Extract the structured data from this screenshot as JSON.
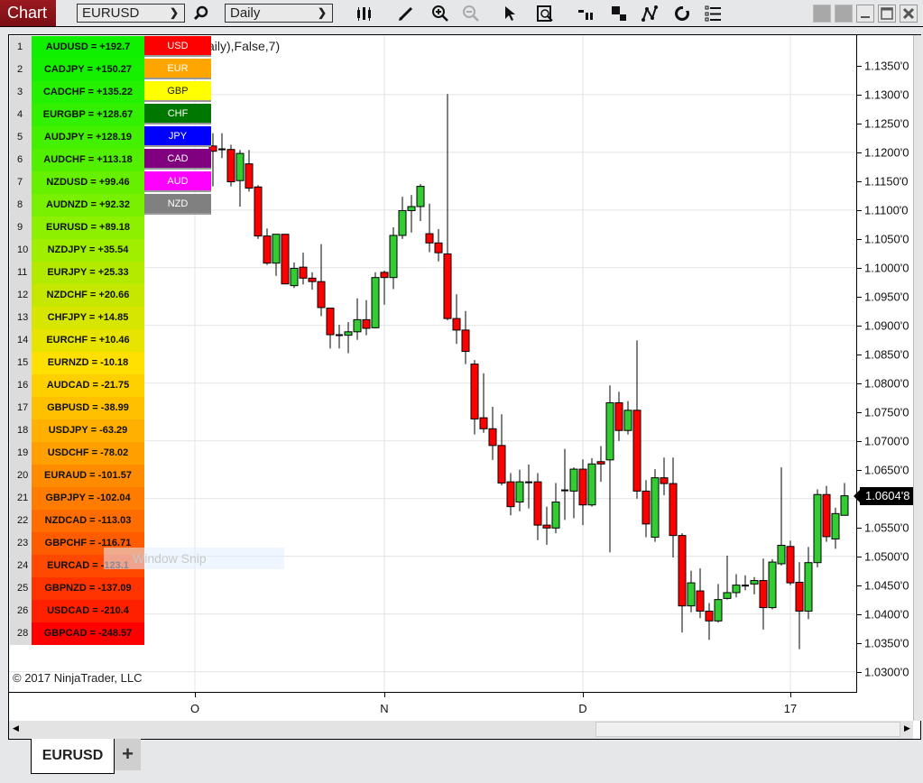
{
  "window": {
    "title": "Chart",
    "instrument": "EURUSD",
    "interval": "Daily",
    "tab_label": "EURUSD",
    "add_tab_label": "+"
  },
  "toolbar": {
    "icons": [
      "bar-type-icon",
      "draw-pencil-icon",
      "zoom-in-icon",
      "zoom-out-icon",
      "pointer-icon",
      "data-box-icon",
      "chart-trader-icon",
      "tile-windows-icon",
      "drawing-tool-icon",
      "reload-icon",
      "properties-list-icon"
    ]
  },
  "overlay": {
    "indicator_label": "aily),False,7)",
    "copyright": "© 2017 NinjaTrader, LLC",
    "snip_text": "Window Snip",
    "last_price_label": "1.0604'8"
  },
  "rank_table": [
    {
      "rank": "1",
      "label": "AUDUSD = +192.7",
      "color": "#0ff000"
    },
    {
      "rank": "2",
      "label": "CADJPY = +150.27",
      "color": "#15f000"
    },
    {
      "rank": "3",
      "label": "CADCHF = +135.22",
      "color": "#24f000"
    },
    {
      "rank": "4",
      "label": "EURGBP = +128.67",
      "color": "#33f000"
    },
    {
      "rank": "5",
      "label": "AUDJPY = +128.19",
      "color": "#42f000"
    },
    {
      "rank": "6",
      "label": "AUDCHF = +113.18",
      "color": "#52f000"
    },
    {
      "rank": "7",
      "label": "NZDUSD = +99.46",
      "color": "#66f000"
    },
    {
      "rank": "8",
      "label": "AUDNZD = +92.32",
      "color": "#78f000"
    },
    {
      "rank": "9",
      "label": "EURUSD = +89.18",
      "color": "#8cf000"
    },
    {
      "rank": "10",
      "label": "NZDJPY = +35.54",
      "color": "#a0ee00"
    },
    {
      "rank": "11",
      "label": "EURJPY = +25.33",
      "color": "#b4ea00"
    },
    {
      "rank": "12",
      "label": "NZDCHF = +20.66",
      "color": "#c6e800"
    },
    {
      "rank": "13",
      "label": "CHFJPY = +14.85",
      "color": "#d6e600"
    },
    {
      "rank": "14",
      "label": "EURCHF = +10.46",
      "color": "#e6e400"
    },
    {
      "rank": "15",
      "label": "EURNZD = -10.18",
      "color": "#ffe000"
    },
    {
      "rank": "16",
      "label": "AUDCAD = -21.75",
      "color": "#ffd000"
    },
    {
      "rank": "17",
      "label": "GBPUSD = -38.99",
      "color": "#ffc000"
    },
    {
      "rank": "18",
      "label": "USDJPY = -63.29",
      "color": "#ffb000"
    },
    {
      "rank": "19",
      "label": "USDCHF = -78.02",
      "color": "#ffa000"
    },
    {
      "rank": "20",
      "label": "EURAUD = -101.57",
      "color": "#ff8c00"
    },
    {
      "rank": "21",
      "label": "GBPJPY = -102.04",
      "color": "#ff7c00"
    },
    {
      "rank": "22",
      "label": "NZDCAD = -113.03",
      "color": "#ff6c00"
    },
    {
      "rank": "23",
      "label": "GBPCHF = -116.71",
      "color": "#ff5c00"
    },
    {
      "rank": "24",
      "label": "EURCAD = -123.1",
      "color": "#ff4800"
    },
    {
      "rank": "25",
      "label": "GBPNZD = -137.09",
      "color": "#ff3400"
    },
    {
      "rank": "26",
      "label": "USDCAD = -210.4",
      "color": "#ff2000"
    },
    {
      "rank": "28",
      "label": "GBPCAD = -248.57",
      "color": "#ff0000"
    }
  ],
  "currencies": [
    {
      "label": "USD",
      "bg": "#ff0000",
      "fg": "#ffffff"
    },
    {
      "label": "EUR",
      "bg": "#ffa500",
      "fg": "#ffffff"
    },
    {
      "label": "GBP",
      "bg": "#ffff00",
      "fg": "#222222"
    },
    {
      "label": "CHF",
      "bg": "#007800",
      "fg": "#ffffff"
    },
    {
      "label": "JPY",
      "bg": "#0000ff",
      "fg": "#ffffff"
    },
    {
      "label": "CAD",
      "bg": "#800080",
      "fg": "#ffffff"
    },
    {
      "label": "AUD",
      "bg": "#ff00ff",
      "fg": "#ffffff"
    },
    {
      "label": "NZD",
      "bg": "#808080",
      "fg": "#ffffff"
    }
  ],
  "chart_data": {
    "type": "candlestick",
    "title": "EURUSD Daily",
    "xlabel": "",
    "ylabel": "",
    "ylim": [
      1.0265,
      1.1403
    ],
    "grid": true,
    "up_color": "#33cc33",
    "down_color": "#ff0000",
    "y_ticks": [
      "1.1350'0",
      "1.1300'0",
      "1.1250'0",
      "1.1200'0",
      "1.1150'0",
      "1.1100'0",
      "1.1050'0",
      "1.1000'0",
      "1.0950'0",
      "1.0900'0",
      "1.0850'0",
      "1.0800'0",
      "1.0750'0",
      "1.0700'0",
      "1.0650'0",
      "1.0550'0",
      "1.0500'0",
      "1.0450'0",
      "1.0400'0",
      "1.0350'0",
      "1.0300'0"
    ],
    "y_tick_values": [
      1.135,
      1.13,
      1.125,
      1.12,
      1.115,
      1.11,
      1.105,
      1.1,
      1.095,
      1.09,
      1.085,
      1.08,
      1.075,
      1.07,
      1.065,
      1.055,
      1.05,
      1.045,
      1.04,
      1.035,
      1.03
    ],
    "x_ticks": [
      {
        "label": "O",
        "bar_index": -2
      },
      {
        "label": "N",
        "bar_index": 19
      },
      {
        "label": "D",
        "bar_index": 41
      },
      {
        "label": "17",
        "bar_index": 64
      }
    ],
    "last_price": 1.06048,
    "candles": [
      [
        1.1211,
        1.1233,
        1.1141,
        1.1202
      ],
      [
        1.1206,
        1.1233,
        1.119,
        1.1205
      ],
      [
        1.1205,
        1.1213,
        1.1141,
        1.1149
      ],
      [
        1.1151,
        1.1204,
        1.1106,
        1.1198
      ],
      [
        1.118,
        1.1204,
        1.1132,
        1.1138
      ],
      [
        1.114,
        1.1143,
        1.105,
        1.1055
      ],
      [
        1.1055,
        1.1068,
        1.1005,
        1.1008
      ],
      [
        1.1008,
        1.1058,
        1.0986,
        1.1058
      ],
      [
        1.1058,
        1.1058,
        1.0972,
        1.0972
      ],
      [
        1.0969,
        1.1009,
        1.0965,
        1.0999
      ],
      [
        1.1001,
        1.1026,
        1.0971,
        1.0982
      ],
      [
        1.0982,
        1.0992,
        1.0962,
        1.0976
      ],
      [
        1.0976,
        1.1041,
        1.0916,
        1.0931
      ],
      [
        1.093,
        1.093,
        1.086,
        1.0884
      ],
      [
        1.0884,
        1.0901,
        1.086,
        1.0881
      ],
      [
        1.0883,
        1.0906,
        1.0852,
        1.0889
      ],
      [
        1.0889,
        1.0947,
        1.0875,
        1.091
      ],
      [
        1.091,
        1.0944,
        1.0883,
        1.0895
      ],
      [
        1.0896,
        1.0992,
        1.0895,
        1.0983
      ],
      [
        1.0992,
        1.0995,
        1.0936,
        1.0983
      ],
      [
        1.0983,
        1.107,
        1.0963,
        1.1056
      ],
      [
        1.1056,
        1.1123,
        1.105,
        1.1099
      ],
      [
        1.1099,
        1.1126,
        1.1061,
        1.1106
      ],
      [
        1.1106,
        1.1145,
        1.1081,
        1.1141
      ],
      [
        1.1059,
        1.1111,
        1.1027,
        1.1043
      ],
      [
        1.1043,
        1.1067,
        1.1011,
        1.1026
      ],
      [
        1.1024,
        1.1301,
        1.0909,
        1.0912
      ],
      [
        1.0912,
        1.0954,
        1.0868,
        1.0892
      ],
      [
        1.0892,
        1.0925,
        1.0833,
        1.0855
      ],
      [
        1.0833,
        1.084,
        1.0711,
        1.0738
      ],
      [
        1.074,
        1.0817,
        1.0714,
        1.0721
      ],
      [
        1.0721,
        1.0759,
        1.0667,
        1.0692
      ],
      [
        1.0692,
        1.0746,
        1.0623,
        1.0627
      ],
      [
        1.0629,
        1.0644,
        1.0571,
        1.0586
      ],
      [
        1.0594,
        1.065,
        1.0578,
        1.0629
      ],
      [
        1.0629,
        1.0659,
        1.0583,
        1.0629
      ],
      [
        1.0629,
        1.0644,
        1.0528,
        1.0554
      ],
      [
        1.0554,
        1.0586,
        1.052,
        1.0549
      ],
      [
        1.0549,
        1.0627,
        1.054,
        1.0594
      ],
      [
        1.0612,
        1.0686,
        1.0563,
        1.0615
      ],
      [
        1.0613,
        1.0654,
        1.0566,
        1.0651
      ],
      [
        1.0651,
        1.0668,
        1.0554,
        1.0589
      ],
      [
        1.0589,
        1.067,
        1.0586,
        1.066
      ],
      [
        1.0664,
        1.0691,
        1.0629,
        1.066
      ],
      [
        1.0667,
        1.0796,
        1.0507,
        1.0766
      ],
      [
        1.0766,
        1.0785,
        1.07,
        1.0718
      ],
      [
        1.0718,
        1.0769,
        1.0711,
        1.0753
      ],
      [
        1.0753,
        1.0874,
        1.06,
        1.0613
      ],
      [
        1.0613,
        1.0632,
        1.0533,
        1.0556
      ],
      [
        1.0533,
        1.0651,
        1.0525,
        1.0636
      ],
      [
        1.0636,
        1.0671,
        1.0606,
        1.0626
      ],
      [
        1.0626,
        1.0671,
        1.0498,
        1.0536
      ],
      [
        1.0536,
        1.054,
        1.0368,
        1.0414
      ],
      [
        1.0414,
        1.0475,
        1.0403,
        1.0454
      ],
      [
        1.044,
        1.0479,
        1.0393,
        1.0405
      ],
      [
        1.0405,
        1.0419,
        1.0355,
        1.0388
      ],
      [
        1.0388,
        1.0452,
        1.0385,
        1.0425
      ],
      [
        1.0427,
        1.0501,
        1.0425,
        1.0437
      ],
      [
        1.0437,
        1.0469,
        1.0429,
        1.045
      ],
      [
        1.045,
        1.0467,
        1.0441,
        1.0449
      ],
      [
        1.0452,
        1.0464,
        1.0434,
        1.0458
      ],
      [
        1.0458,
        1.0496,
        1.0373,
        1.0411
      ],
      [
        1.0411,
        1.0495,
        1.0408,
        1.049
      ],
      [
        1.0487,
        1.0654,
        1.0484,
        1.0519
      ],
      [
        1.0517,
        1.0527,
        1.045,
        1.0454
      ],
      [
        1.0455,
        1.049,
        1.0339,
        1.0405
      ],
      [
        1.0405,
        1.0516,
        1.0391,
        1.0489
      ],
      [
        1.0489,
        1.0616,
        1.0481,
        1.0607
      ],
      [
        1.0607,
        1.0622,
        1.0525,
        1.0534
      ],
      [
        1.053,
        1.0584,
        1.0513,
        1.0574
      ],
      [
        1.0571,
        1.0627,
        1.0571,
        1.06048
      ]
    ]
  }
}
